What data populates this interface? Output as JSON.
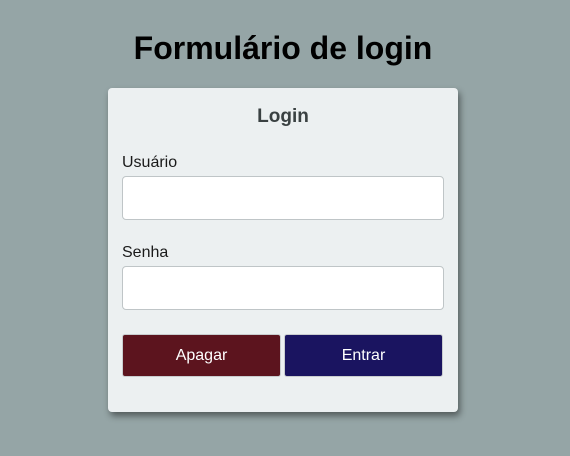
{
  "page": {
    "title": "Formulário de login"
  },
  "form": {
    "heading": "Login",
    "username": {
      "label": "Usuário",
      "value": ""
    },
    "password": {
      "label": "Senha",
      "value": ""
    },
    "buttons": {
      "clear_label": "Apagar",
      "submit_label": "Entrar"
    }
  },
  "colors": {
    "background": "#95a5a6",
    "card": "#ecf0f1",
    "clear_button": "#5c141e",
    "submit_button": "#1a1460"
  }
}
